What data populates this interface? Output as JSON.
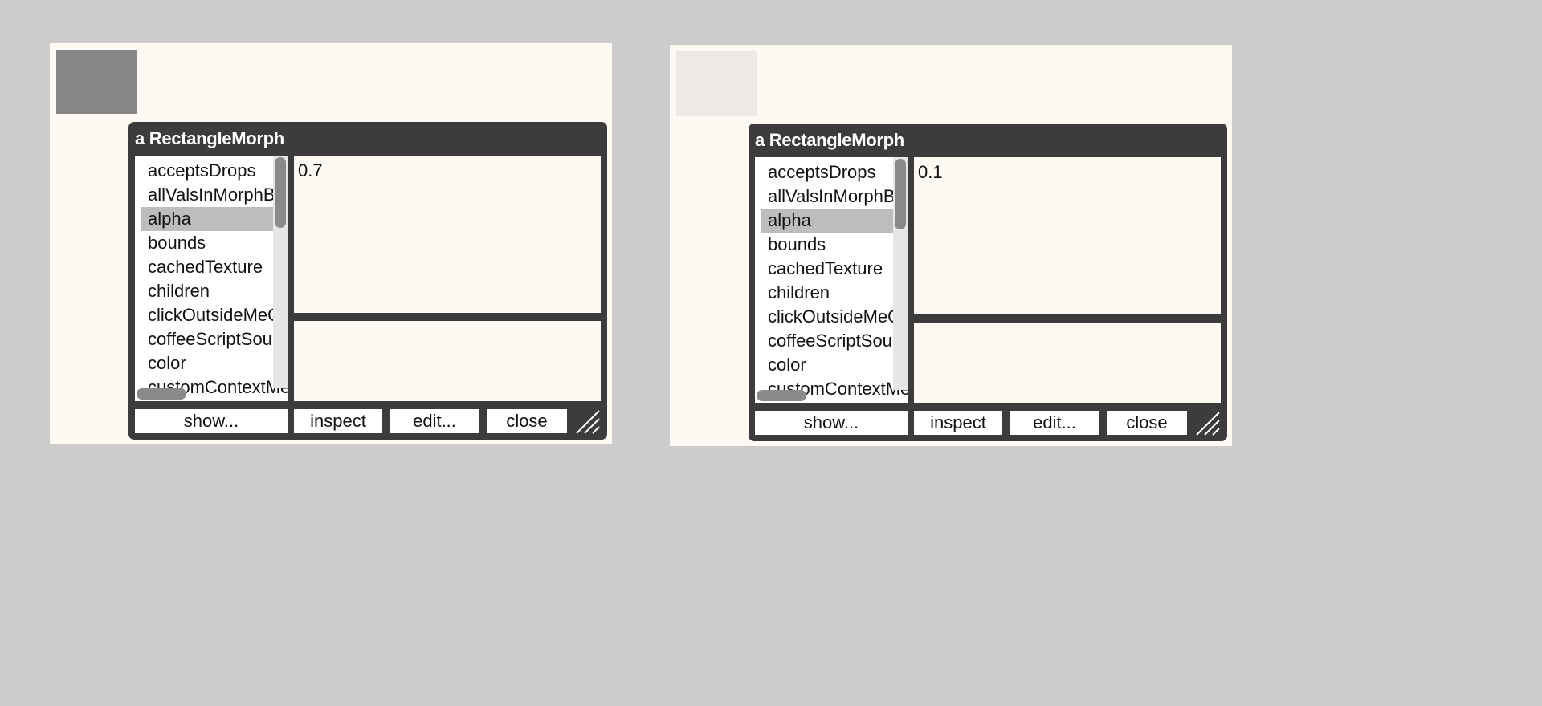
{
  "worlds": [
    {
      "sample_color": "#878787",
      "inspector": {
        "title": "a RectangleMorph",
        "properties": [
          "acceptsDrops",
          "allValsInMorphByRef",
          "alpha",
          "bounds",
          "cachedTexture",
          "children",
          "clickOutsideMeOrAnyOfMeChildrenCallback",
          "coffeeScriptSource",
          "color",
          "customContextMenu"
        ],
        "selected_index": 2,
        "value": "0.7",
        "buttons": {
          "show": "show...",
          "inspect": "inspect",
          "edit": "edit...",
          "close": "close"
        }
      }
    },
    {
      "sample_color": "#ece9e6",
      "inspector": {
        "title": "a RectangleMorph",
        "properties": [
          "acceptsDrops",
          "allValsInMorphByRef",
          "alpha",
          "bounds",
          "cachedTexture",
          "children",
          "clickOutsideMeOrAnyOfMeChildrenCallback",
          "coffeeScriptSource",
          "color",
          "customContextMenu"
        ],
        "selected_index": 2,
        "value": "0.1",
        "buttons": {
          "show": "show...",
          "inspect": "inspect",
          "edit": "edit...",
          "close": "close"
        }
      }
    }
  ],
  "icons": {
    "resize": "resize-grip-icon"
  },
  "colors": {
    "desktop": "#cccccc",
    "world": "#fff9f4",
    "inspector_frame": "#3c3c3c",
    "selection": "#bdbdbd"
  }
}
